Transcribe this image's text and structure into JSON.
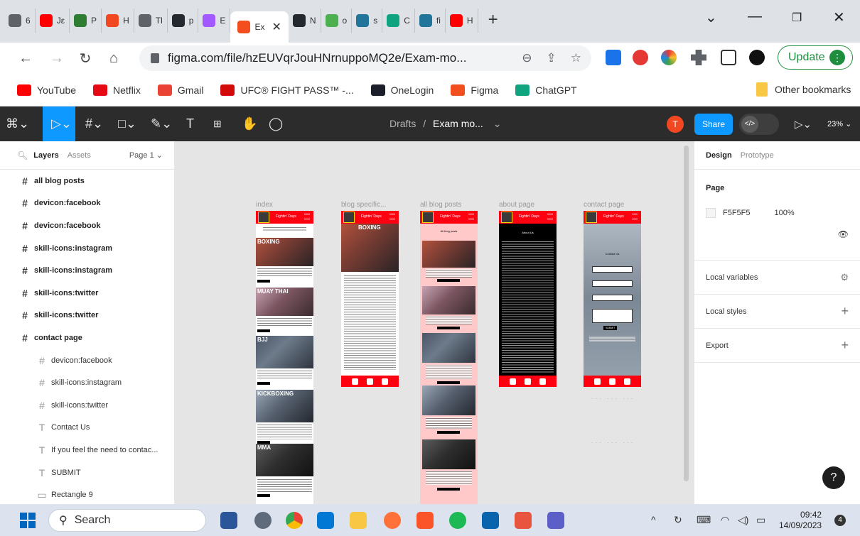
{
  "browser": {
    "tabs": [
      {
        "label": "6",
        "color": "#5f6368",
        "icon": "grid-icon"
      },
      {
        "label": "Jε",
        "color": "#ff0000",
        "icon": "youtube-icon"
      },
      {
        "label": "P",
        "color": "#2e7d32",
        "icon": "app-icon"
      },
      {
        "label": "H",
        "color": "#f24822",
        "icon": "figma-orange-icon"
      },
      {
        "label": "Tl",
        "color": "#5f6368",
        "icon": "globe-icon"
      },
      {
        "label": "p",
        "color": "#24292f",
        "icon": "github-icon"
      },
      {
        "label": "E",
        "color": "#a259ff",
        "icon": "figma-icon"
      }
    ],
    "active_tab": {
      "label": "Ex",
      "close": "✕"
    },
    "tabs_after": [
      {
        "label": "N",
        "color": "#24292f",
        "icon": "github-icon"
      },
      {
        "label": "o",
        "color": "#4caf50",
        "icon": "circle-icon"
      },
      {
        "label": "s",
        "color": "#21759b",
        "icon": "wordpress-icon"
      },
      {
        "label": "C",
        "color": "#10a37f",
        "icon": "chatgpt-icon"
      },
      {
        "label": "fi",
        "color": "#21759b",
        "icon": "wordpress-icon"
      },
      {
        "label": "H",
        "color": "#ff0000",
        "icon": "youtube-icon"
      }
    ],
    "new_tab": "+",
    "url": "figma.com/file/hzEUVqrJouHNrnuppoMQ2e/Exam-mo...",
    "update_label": "Update",
    "bookmarks": [
      {
        "label": "YouTube",
        "color": "#ff0000",
        "icon": "youtube-icon"
      },
      {
        "label": "Netflix",
        "color": "#e50914",
        "icon": "netflix-icon"
      },
      {
        "label": "Gmail",
        "color": "#ea4335",
        "icon": "gmail-icon"
      },
      {
        "label": "UFC® FIGHT PASS™ -...",
        "color": "#d20a0a",
        "icon": "ufc-icon"
      },
      {
        "label": "OneLogin",
        "color": "#1c1f2a",
        "icon": "onelogin-icon"
      },
      {
        "label": "Figma",
        "color": "#f24e1e",
        "icon": "figma-icon"
      },
      {
        "label": "ChatGPT",
        "color": "#10a37f",
        "icon": "chatgpt-icon"
      }
    ],
    "other_bookmarks": "Other bookmarks"
  },
  "figma": {
    "breadcrumb_drafts": "Drafts",
    "breadcrumb_sep": "/",
    "file_name": "Exam mo...",
    "avatar": "T",
    "share": "Share",
    "zoom": "23%",
    "left_panel": {
      "layers_tab": "Layers",
      "assets_tab": "Assets",
      "page": "Page 1",
      "layers": [
        {
          "label": "all blog posts",
          "type": "frame",
          "level": 0
        },
        {
          "label": "devicon:facebook",
          "type": "frame",
          "level": 0
        },
        {
          "label": "devicon:facebook",
          "type": "frame",
          "level": 0
        },
        {
          "label": "skill-icons:instagram",
          "type": "frame",
          "level": 0
        },
        {
          "label": "skill-icons:instagram",
          "type": "frame",
          "level": 0
        },
        {
          "label": "skill-icons:twitter",
          "type": "frame",
          "level": 0
        },
        {
          "label": "skill-icons:twitter",
          "type": "frame",
          "level": 0
        },
        {
          "label": "contact page",
          "type": "frame",
          "level": 0
        },
        {
          "label": "devicon:facebook",
          "type": "frame",
          "level": 1
        },
        {
          "label": "skill-icons:instagram",
          "type": "frame",
          "level": 1
        },
        {
          "label": "skill-icons:twitter",
          "type": "frame",
          "level": 1
        },
        {
          "label": "Contact Us",
          "type": "text",
          "level": 1
        },
        {
          "label": "If you feel the need to contac...",
          "type": "text",
          "level": 1
        },
        {
          "label": "SUBMIT",
          "type": "text",
          "level": 1
        },
        {
          "label": "Rectangle 9",
          "type": "rect",
          "level": 1
        }
      ]
    },
    "canvas": {
      "frames": [
        "index",
        "blog specific...",
        "all blog posts",
        "about page",
        "contact page"
      ],
      "mobile_brand": "Fightin' Days",
      "sections": [
        "BOXING",
        "MUAY THAI",
        "BJJ",
        "KICKBOXING",
        "MMA"
      ],
      "blog_heading": "BOXING",
      "all_posts_title": "All blog posts",
      "about_title": "About Us",
      "contact_title": "Contact Us",
      "submit": "SUBMIT"
    },
    "right_panel": {
      "design_tab": "Design",
      "prototype_tab": "Prototype",
      "page_title": "Page",
      "page_color": "F5F5F5",
      "page_opacity": "100%",
      "local_variables": "Local variables",
      "local_styles": "Local styles",
      "export": "Export"
    },
    "help": "?"
  },
  "taskbar": {
    "search": "Search",
    "time": "09:42",
    "date": "14/09/2023",
    "notifications": "4"
  }
}
